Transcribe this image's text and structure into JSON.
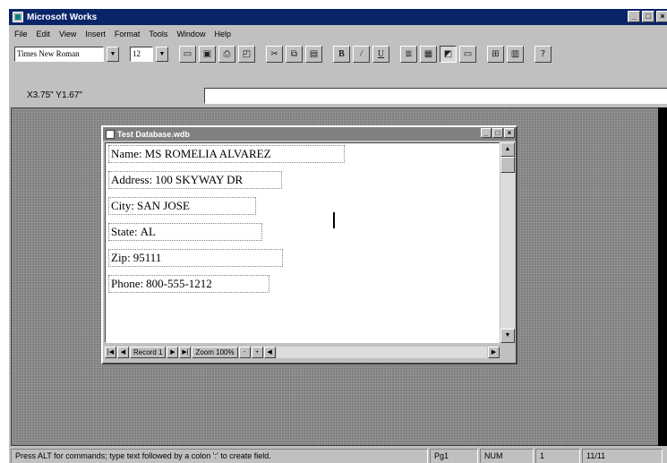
{
  "window": {
    "title": "Microsoft Works",
    "buttons": [
      "_",
      "□",
      "×"
    ]
  },
  "menu": [
    "File",
    "Edit",
    "View",
    "Insert",
    "Format",
    "Tools",
    "Window",
    "Help"
  ],
  "toolbar": {
    "font_name": "Times New Roman",
    "font_size": "12",
    "dropdown_glyph": "▼",
    "buttons": [
      {
        "name": "new-icon",
        "glyph": "▭"
      },
      {
        "name": "save-icon",
        "glyph": "▣"
      },
      {
        "name": "print-icon",
        "glyph": "⎙"
      },
      {
        "name": "print-preview-icon",
        "glyph": "◰"
      },
      {
        "name": "cut-icon",
        "glyph": "✂"
      },
      {
        "name": "copy-icon",
        "glyph": "⧉"
      },
      {
        "name": "paste-icon",
        "glyph": "▤"
      },
      {
        "name": "bold-button",
        "glyph": "B",
        "cls": "bold"
      },
      {
        "name": "italic-button",
        "glyph": "/",
        "cls": "ital"
      },
      {
        "name": "underline-button",
        "glyph": "U",
        "cls": "und"
      },
      {
        "name": "list-view-icon",
        "glyph": "≣"
      },
      {
        "name": "form-view-icon",
        "glyph": "▦"
      },
      {
        "name": "form-design-icon",
        "glyph": "◩",
        "cls": "pressed"
      },
      {
        "name": "report-view-icon",
        "glyph": "▭"
      },
      {
        "name": "insert-field-icon",
        "glyph": "⊞"
      },
      {
        "name": "address-book-icon",
        "glyph": "▥"
      },
      {
        "name": "help-icon",
        "glyph": "?"
      }
    ]
  },
  "position": {
    "coords": "X3.75\" Y1.67\""
  },
  "document": {
    "title": "Test Database.wdb",
    "buttons": [
      "_",
      "□",
      "×"
    ],
    "fields": [
      {
        "label": "Name",
        "value": "MS ROMELIA ALVAREZ"
      },
      {
        "label": "Address",
        "value": "100 SKYWAY DR"
      },
      {
        "label": "City",
        "value": "SAN JOSE"
      },
      {
        "label": "State",
        "value": "AL"
      },
      {
        "label": "Zip",
        "value": "95111"
      },
      {
        "label": "Phone",
        "value": "800-555-1212"
      }
    ],
    "nav": {
      "record_label": "Record 1",
      "zoom_label": "Zoom 100%",
      "minus": "-",
      "plus": "+"
    }
  },
  "status": {
    "message": "Press ALT for commands; type text followed by a colon ':' to create field.",
    "page": "Pg1",
    "num": "NUM",
    "record": "1",
    "count": "11/11"
  }
}
